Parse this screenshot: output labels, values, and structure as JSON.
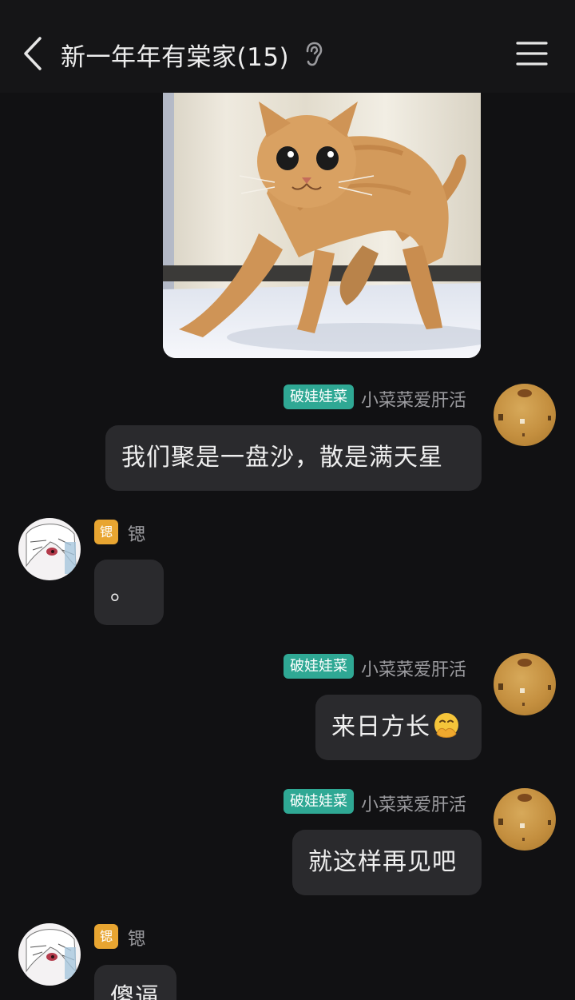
{
  "header": {
    "title": "新一年年有棠家(15)",
    "icons": [
      "back-icon",
      "ear-icon",
      "menu-icon"
    ]
  },
  "image_message": {
    "description_icon": "scared-cat-image"
  },
  "messages": [
    {
      "side": "right",
      "badge": "破娃娃菜",
      "badge_color": "#2fa894",
      "nickname": "小菜菜爱肝活",
      "text": "我们聚是一盘沙，散是满天星"
    },
    {
      "side": "left",
      "badge": "锶",
      "badge_color": "#e8a531",
      "nickname": "锶",
      "text": "。"
    },
    {
      "side": "right",
      "badge": "破娃娃菜",
      "badge_color": "#2fa894",
      "nickname": "小菜菜爱肝活",
      "text": "来日方长",
      "emoji": "face-with-hand-over-mouth"
    },
    {
      "side": "right",
      "badge": "破娃娃菜",
      "badge_color": "#2fa894",
      "nickname": "小菜菜爱肝活",
      "text": "就这样再见吧"
    },
    {
      "side": "left",
      "badge": "锶",
      "badge_color": "#e8a531",
      "nickname": "锶",
      "text": "傻逼"
    }
  ]
}
